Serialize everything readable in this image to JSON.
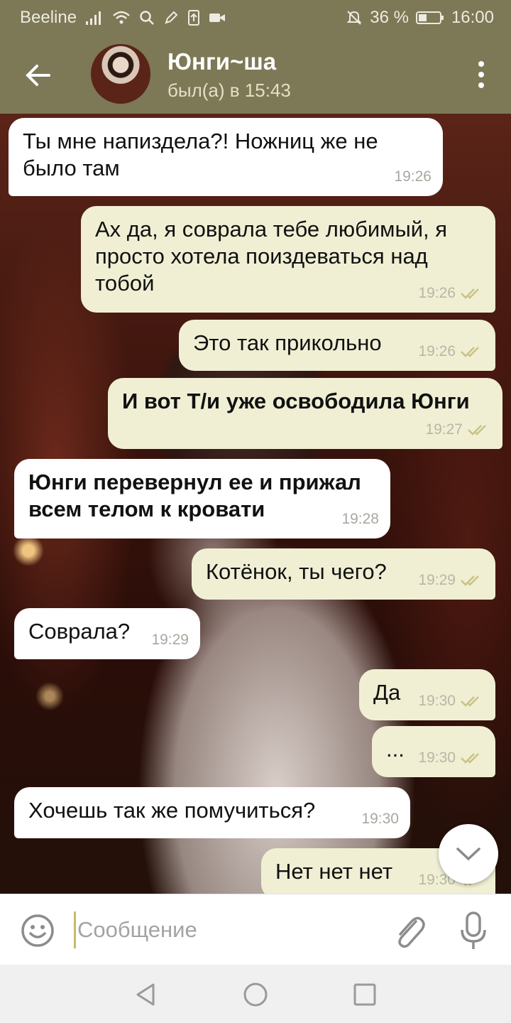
{
  "status_bar": {
    "carrier": "Beeline",
    "battery": "36 %",
    "time": "16:00"
  },
  "header": {
    "title": "Юнги~ша",
    "status": "был(а) в 15:43"
  },
  "messages": [
    {
      "dir": "in",
      "bold": false,
      "text": "Ты мне напиздела?! Ножниц же не было там",
      "time": "19:26"
    },
    {
      "dir": "out",
      "bold": false,
      "text": "Ах да, я соврала тебе любимый, я просто хотела поиздеваться над тобой",
      "time": "19:26",
      "read": true
    },
    {
      "dir": "out",
      "bold": false,
      "text": "Это так прикольно",
      "time": "19:26",
      "read": true
    },
    {
      "dir": "out",
      "bold": true,
      "text": "И вот Т/и уже освободила Юнги",
      "time": "19:27",
      "read": true
    },
    {
      "dir": "in",
      "bold": true,
      "text": "Юнги перевернул ее и прижал всем телом к кровати",
      "time": "19:28"
    },
    {
      "dir": "out",
      "bold": false,
      "text": "Котёнок, ты чего?",
      "time": "19:29",
      "read": true
    },
    {
      "dir": "in",
      "bold": false,
      "text": "Соврала?",
      "time": "19:29"
    },
    {
      "dir": "out",
      "bold": false,
      "text": "Да",
      "time": "19:30",
      "read": true
    },
    {
      "dir": "out",
      "bold": false,
      "text": "...",
      "time": "19:30",
      "read": true
    },
    {
      "dir": "in",
      "bold": false,
      "text": "Хочешь так же помучиться?",
      "time": "19:30"
    },
    {
      "dir": "out",
      "bold": false,
      "text": "Нет нет нет",
      "time": "19:30",
      "read": true
    }
  ],
  "input": {
    "placeholder": "Сообщение"
  },
  "colors": {
    "header": "#7d7856",
    "bubble_in": "#ffffff",
    "bubble_out": "#f0efd4",
    "read_ticks": "#c9c283"
  }
}
